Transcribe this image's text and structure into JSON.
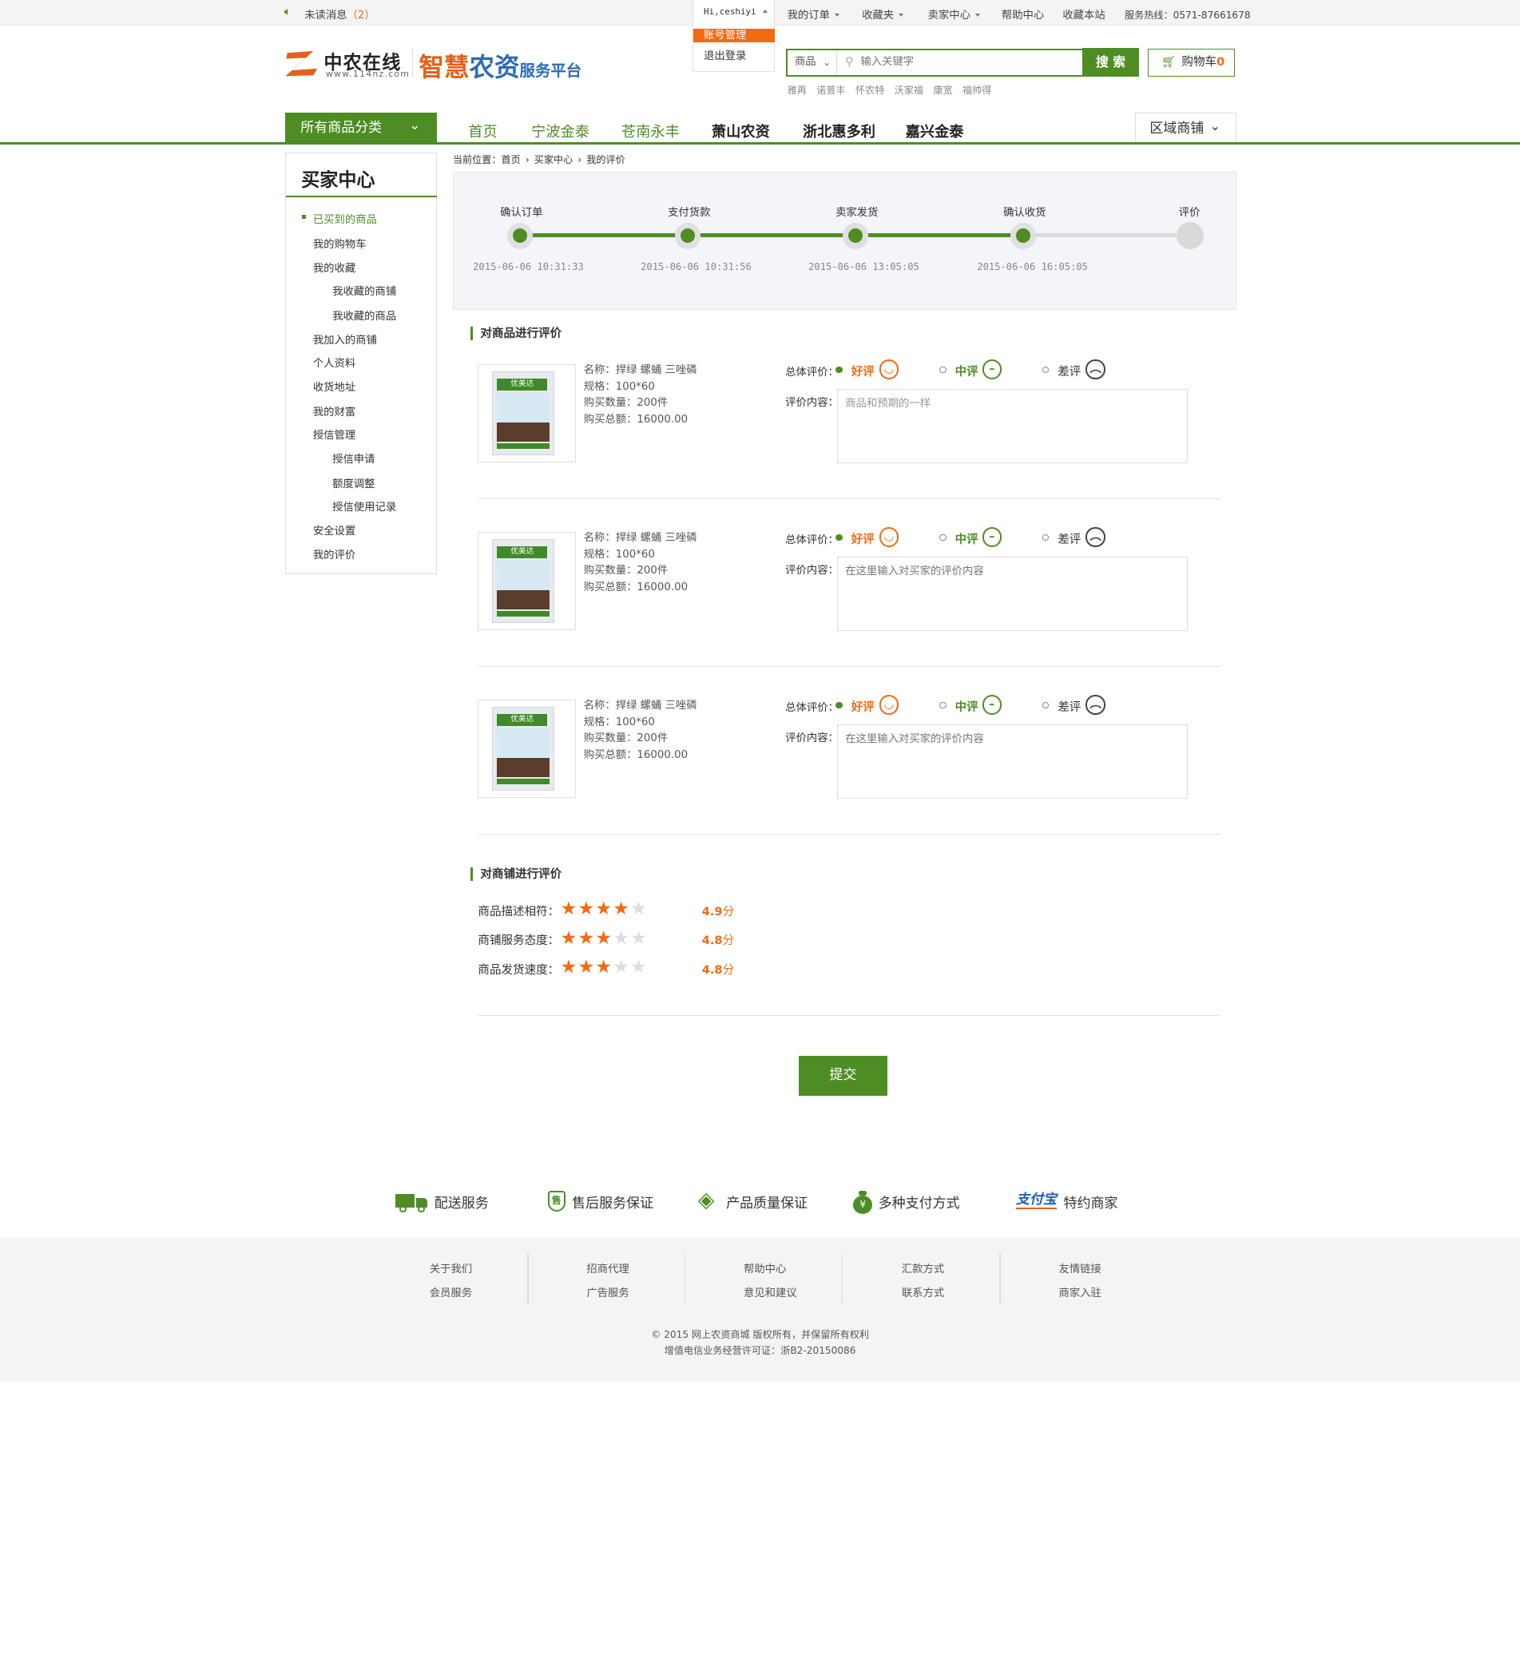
{
  "topbar": {
    "unread_label": "未读消息",
    "unread_count": "（2）",
    "user_greeting": "Hi,ceshiyi",
    "user_menu": [
      "账号管理",
      "退出登录"
    ],
    "links": [
      "我的订单",
      "收藏夹",
      "卖家中心",
      "帮助中心",
      "收藏本站"
    ],
    "hotline": "服务热线：0571-87661678"
  },
  "logo": {
    "name": "中农在线",
    "url": "www.114nz.com",
    "slogan_part1": "智慧",
    "slogan_part2": "农资",
    "slogan_part3": "服务平台"
  },
  "search": {
    "category": "商品",
    "placeholder": "输入关键字",
    "button": "搜 索",
    "hot_words": [
      "雅再",
      "诺普丰",
      "怀农特",
      "沃家福",
      "康宽",
      "福帅得"
    ]
  },
  "cart": {
    "label": "购物车",
    "count": "0"
  },
  "nav": {
    "all_categories": "所有商品分类",
    "items": [
      "首页",
      "宁波金泰",
      "苍南永丰",
      "萧山农资",
      "浙北惠多利",
      "嘉兴金泰"
    ],
    "region": "区域商铺"
  },
  "sidebar": {
    "title": "买家中心",
    "items": [
      "已买到的商品",
      "我的购物车",
      "我的收藏",
      "我收藏的商铺",
      "我收藏的商品",
      "我加入的商铺",
      "个人资料",
      "收货地址",
      "我的财富",
      "授信管理",
      "授信申请",
      "额度调整",
      "授信使用记录",
      "安全设置",
      "我的评价"
    ]
  },
  "breadcrumb": {
    "prefix": "当前位置：",
    "items": [
      "首页",
      "买家中心",
      "我的评价"
    ]
  },
  "progress": {
    "steps": [
      "确认订单",
      "支付货款",
      "卖家发货",
      "确认收货",
      "评价"
    ],
    "times": [
      "2015-06-06 10:31:33",
      "2015-06-06 10:31:56",
      "2015-06-06 13:05:05",
      "2015-06-06 16:05:05",
      ""
    ],
    "completed": 4
  },
  "product_review": {
    "title": "对商品进行评价",
    "overall_label": "总体评价：",
    "content_label": "评价内容：",
    "options": [
      "好评",
      "中评",
      "差评"
    ],
    "package_brand": "优美达",
    "items": [
      {
        "name": "名称：捍绿 螺蛹 三唑磷",
        "spec": "规格：100*60",
        "qty": "购买数量：200件",
        "total": "购买总额：16000.00",
        "selected": "好评",
        "content": "商品和预期的一样"
      },
      {
        "name": "名称：捍绿 螺蛹 三唑磷",
        "spec": "规格：100*60",
        "qty": "购买数量：200件",
        "total": "购买总额：16000.00",
        "selected": "好评",
        "content": "",
        "placeholder": "在这里输入对买家的评价内容"
      },
      {
        "name": "名称：捍绿 螺蛹 三唑磷",
        "spec": "规格：100*60",
        "qty": "购买数量：200件",
        "total": "购买总额：16000.00",
        "selected": "好评",
        "content": "",
        "placeholder": "在这里输入对买家的评价内容"
      }
    ]
  },
  "shop_review": {
    "title": "对商铺进行评价",
    "rows": [
      {
        "label": "商品描述相符：",
        "stars": 4,
        "max": 5,
        "score": "4.9",
        "unit": "分"
      },
      {
        "label": "商铺服务态度：",
        "stars": 3,
        "max": 5,
        "score": "4.8",
        "unit": "分"
      },
      {
        "label": "商品发货速度：",
        "stars": 3,
        "max": 5,
        "score": "4.8",
        "unit": "分"
      }
    ]
  },
  "submit": "提交",
  "services": [
    {
      "label": "配送服务",
      "icon": "truck-icon"
    },
    {
      "label": "售后服务保证",
      "icon": "shield-icon"
    },
    {
      "label": "产品质量保证",
      "icon": "diamond-icon"
    },
    {
      "label": "多种支付方式",
      "icon": "money-bag-icon"
    },
    {
      "label": "特约商家",
      "icon": "alipay-logo",
      "logo_text": "支付宝"
    }
  ],
  "footer": {
    "columns": [
      [
        "关于我们",
        "会员服务"
      ],
      [
        "招商代理",
        "广告服务"
      ],
      [
        "帮助中心",
        "意见和建议"
      ],
      [
        "汇款方式",
        "联系方式"
      ],
      [
        "友情链接",
        "商家入驻"
      ]
    ],
    "copyright": "© 2015 网上农资商城 版权所有，并保留所有权利",
    "license": "增值电信业务经营许可证：浙B2-20150086"
  },
  "colors": {
    "primary_green": "#4e8d24",
    "accent_orange": "#f36a12",
    "brand_blue": "#2b6cb5"
  }
}
